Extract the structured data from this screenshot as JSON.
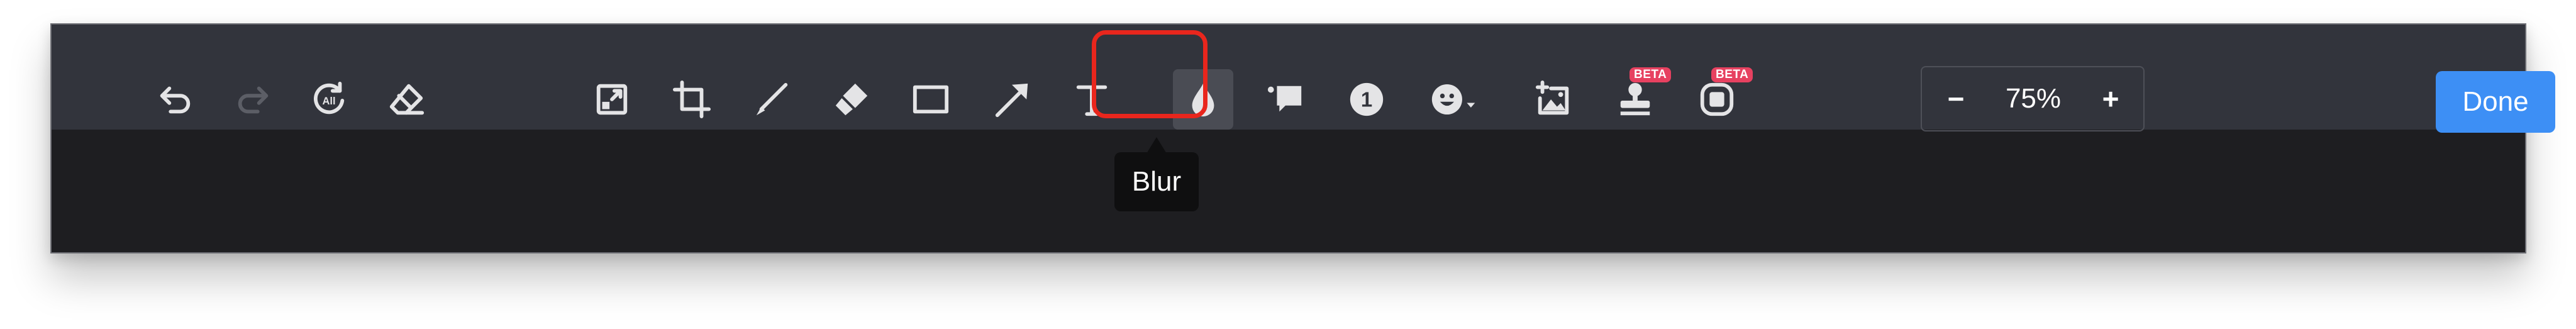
{
  "toolbar": {
    "left_tools": [
      {
        "name": "undo",
        "icon": "undo-icon"
      },
      {
        "name": "redo",
        "icon": "redo-icon",
        "disabled": true
      },
      {
        "name": "revert-all",
        "icon": "revert-all-icon",
        "badge": "All"
      },
      {
        "name": "eraser",
        "icon": "eraser-icon"
      }
    ],
    "tools": [
      {
        "name": "resize",
        "icon": "resize-icon"
      },
      {
        "name": "crop",
        "icon": "crop-icon"
      },
      {
        "name": "pen",
        "icon": "pen-icon"
      },
      {
        "name": "highlighter",
        "icon": "highlighter-icon"
      },
      {
        "name": "rectangle",
        "icon": "rectangle-icon"
      },
      {
        "name": "arrow",
        "icon": "arrow-icon"
      },
      {
        "name": "text",
        "icon": "text-icon"
      },
      {
        "name": "blur",
        "icon": "drop-icon",
        "selected": true
      },
      {
        "name": "callout",
        "icon": "callout-icon"
      },
      {
        "name": "step-number",
        "icon": "number-1-icon",
        "label": "1"
      },
      {
        "name": "emoji",
        "icon": "smiley-icon"
      },
      {
        "name": "add-image",
        "icon": "image-plus-icon"
      },
      {
        "name": "stamp",
        "icon": "stamp-icon",
        "badge": "BETA"
      },
      {
        "name": "record",
        "icon": "record-icon",
        "badge": "BETA"
      }
    ],
    "zoom": {
      "minus": "−",
      "value": "75%",
      "plus": "+"
    },
    "done_label": "Done"
  },
  "tooltip": {
    "text": "Blur"
  },
  "colors": {
    "toolbar_bg": "#32343c",
    "canvas_bg": "#1e1e21",
    "accent": "#3d8ff5",
    "highlight": "#e9261d",
    "beta_badge": "#e74160"
  }
}
